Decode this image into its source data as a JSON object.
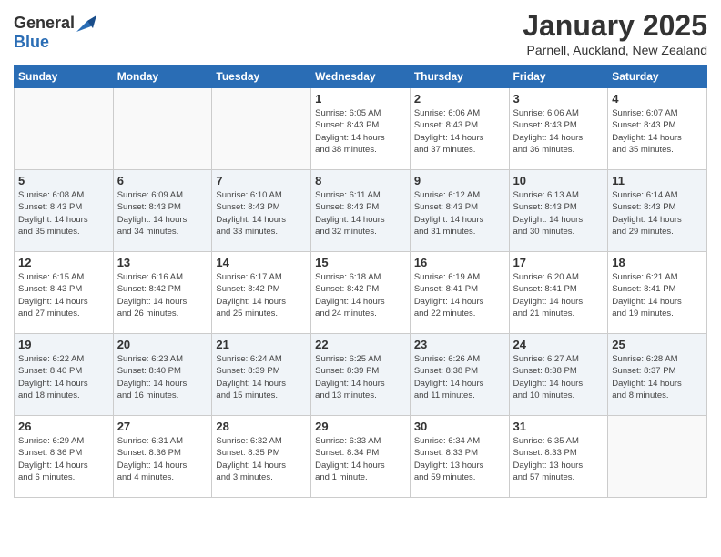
{
  "header": {
    "logo_general": "General",
    "logo_blue": "Blue",
    "month_title": "January 2025",
    "location": "Parnell, Auckland, New Zealand"
  },
  "weekdays": [
    "Sunday",
    "Monday",
    "Tuesday",
    "Wednesday",
    "Thursday",
    "Friday",
    "Saturday"
  ],
  "weeks": [
    [
      {
        "day": "",
        "info": ""
      },
      {
        "day": "",
        "info": ""
      },
      {
        "day": "",
        "info": ""
      },
      {
        "day": "1",
        "info": "Sunrise: 6:05 AM\nSunset: 8:43 PM\nDaylight: 14 hours\nand 38 minutes."
      },
      {
        "day": "2",
        "info": "Sunrise: 6:06 AM\nSunset: 8:43 PM\nDaylight: 14 hours\nand 37 minutes."
      },
      {
        "day": "3",
        "info": "Sunrise: 6:06 AM\nSunset: 8:43 PM\nDaylight: 14 hours\nand 36 minutes."
      },
      {
        "day": "4",
        "info": "Sunrise: 6:07 AM\nSunset: 8:43 PM\nDaylight: 14 hours\nand 35 minutes."
      }
    ],
    [
      {
        "day": "5",
        "info": "Sunrise: 6:08 AM\nSunset: 8:43 PM\nDaylight: 14 hours\nand 35 minutes."
      },
      {
        "day": "6",
        "info": "Sunrise: 6:09 AM\nSunset: 8:43 PM\nDaylight: 14 hours\nand 34 minutes."
      },
      {
        "day": "7",
        "info": "Sunrise: 6:10 AM\nSunset: 8:43 PM\nDaylight: 14 hours\nand 33 minutes."
      },
      {
        "day": "8",
        "info": "Sunrise: 6:11 AM\nSunset: 8:43 PM\nDaylight: 14 hours\nand 32 minutes."
      },
      {
        "day": "9",
        "info": "Sunrise: 6:12 AM\nSunset: 8:43 PM\nDaylight: 14 hours\nand 31 minutes."
      },
      {
        "day": "10",
        "info": "Sunrise: 6:13 AM\nSunset: 8:43 PM\nDaylight: 14 hours\nand 30 minutes."
      },
      {
        "day": "11",
        "info": "Sunrise: 6:14 AM\nSunset: 8:43 PM\nDaylight: 14 hours\nand 29 minutes."
      }
    ],
    [
      {
        "day": "12",
        "info": "Sunrise: 6:15 AM\nSunset: 8:43 PM\nDaylight: 14 hours\nand 27 minutes."
      },
      {
        "day": "13",
        "info": "Sunrise: 6:16 AM\nSunset: 8:42 PM\nDaylight: 14 hours\nand 26 minutes."
      },
      {
        "day": "14",
        "info": "Sunrise: 6:17 AM\nSunset: 8:42 PM\nDaylight: 14 hours\nand 25 minutes."
      },
      {
        "day": "15",
        "info": "Sunrise: 6:18 AM\nSunset: 8:42 PM\nDaylight: 14 hours\nand 24 minutes."
      },
      {
        "day": "16",
        "info": "Sunrise: 6:19 AM\nSunset: 8:41 PM\nDaylight: 14 hours\nand 22 minutes."
      },
      {
        "day": "17",
        "info": "Sunrise: 6:20 AM\nSunset: 8:41 PM\nDaylight: 14 hours\nand 21 minutes."
      },
      {
        "day": "18",
        "info": "Sunrise: 6:21 AM\nSunset: 8:41 PM\nDaylight: 14 hours\nand 19 minutes."
      }
    ],
    [
      {
        "day": "19",
        "info": "Sunrise: 6:22 AM\nSunset: 8:40 PM\nDaylight: 14 hours\nand 18 minutes."
      },
      {
        "day": "20",
        "info": "Sunrise: 6:23 AM\nSunset: 8:40 PM\nDaylight: 14 hours\nand 16 minutes."
      },
      {
        "day": "21",
        "info": "Sunrise: 6:24 AM\nSunset: 8:39 PM\nDaylight: 14 hours\nand 15 minutes."
      },
      {
        "day": "22",
        "info": "Sunrise: 6:25 AM\nSunset: 8:39 PM\nDaylight: 14 hours\nand 13 minutes."
      },
      {
        "day": "23",
        "info": "Sunrise: 6:26 AM\nSunset: 8:38 PM\nDaylight: 14 hours\nand 11 minutes."
      },
      {
        "day": "24",
        "info": "Sunrise: 6:27 AM\nSunset: 8:38 PM\nDaylight: 14 hours\nand 10 minutes."
      },
      {
        "day": "25",
        "info": "Sunrise: 6:28 AM\nSunset: 8:37 PM\nDaylight: 14 hours\nand 8 minutes."
      }
    ],
    [
      {
        "day": "26",
        "info": "Sunrise: 6:29 AM\nSunset: 8:36 PM\nDaylight: 14 hours\nand 6 minutes."
      },
      {
        "day": "27",
        "info": "Sunrise: 6:31 AM\nSunset: 8:36 PM\nDaylight: 14 hours\nand 4 minutes."
      },
      {
        "day": "28",
        "info": "Sunrise: 6:32 AM\nSunset: 8:35 PM\nDaylight: 14 hours\nand 3 minutes."
      },
      {
        "day": "29",
        "info": "Sunrise: 6:33 AM\nSunset: 8:34 PM\nDaylight: 14 hours\nand 1 minute."
      },
      {
        "day": "30",
        "info": "Sunrise: 6:34 AM\nSunset: 8:33 PM\nDaylight: 13 hours\nand 59 minutes."
      },
      {
        "day": "31",
        "info": "Sunrise: 6:35 AM\nSunset: 8:33 PM\nDaylight: 13 hours\nand 57 minutes."
      },
      {
        "day": "",
        "info": ""
      }
    ]
  ]
}
